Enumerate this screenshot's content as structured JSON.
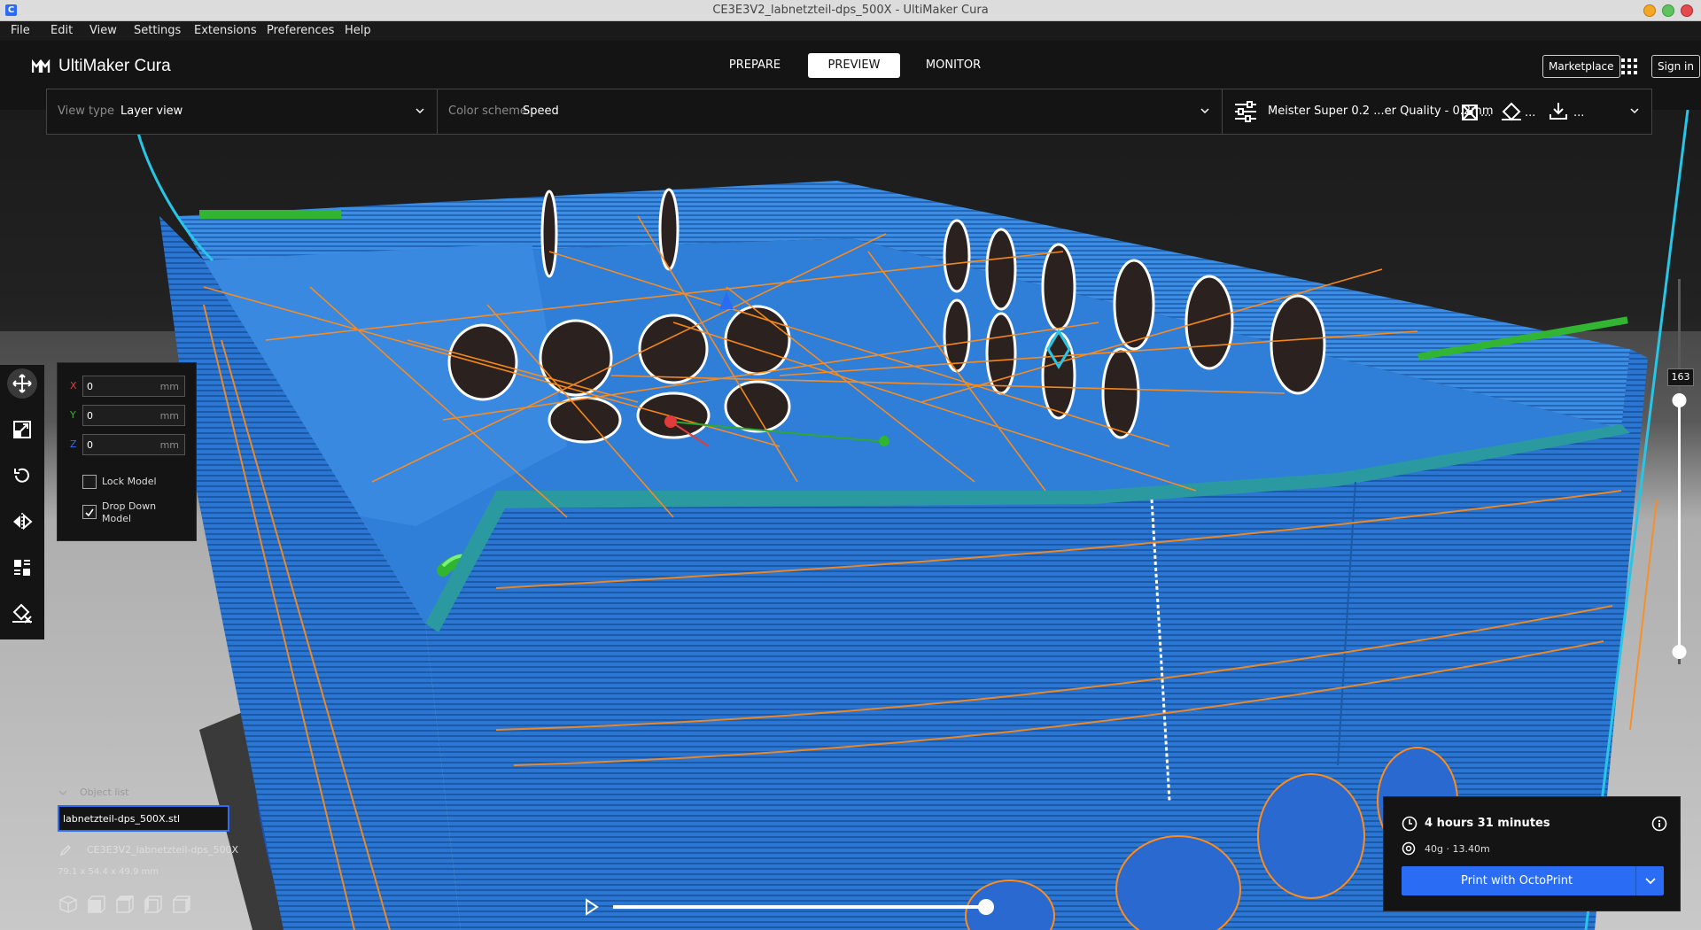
{
  "window": {
    "title": "CE3E3V2_labnetzteil-dps_500X - UltiMaker Cura"
  },
  "menu": {
    "items": [
      "File",
      "Edit",
      "View",
      "Settings",
      "Extensions",
      "Preferences",
      "Help"
    ]
  },
  "header": {
    "logo_text": "UltiMaker Cura",
    "stages": [
      "PREPARE",
      "PREVIEW",
      "MONITOR"
    ],
    "active_stage": "PREVIEW",
    "marketplace_label": "Marketplace",
    "signin_label": "Sign in"
  },
  "viewbar": {
    "view_type_label": "View type",
    "view_type_value": "Layer view",
    "color_scheme_label": "Color scheme",
    "color_scheme_value": "Speed",
    "profile_value": "Meister Super 0.2 ...er Quality - 0.2mm",
    "support_ellipsis": "...",
    "adhesion_ellipsis": "...",
    "extra_ellipsis": "..."
  },
  "move_panel": {
    "x_label": "X",
    "y_label": "Y",
    "z_label": "Z",
    "x_value": "0",
    "y_value": "0",
    "z_value": "0",
    "unit": "mm",
    "lock_model_label": "Lock Model",
    "drop_down_label": "Drop Down Model",
    "lock_model_checked": false,
    "drop_down_checked": true
  },
  "object_list": {
    "header": "Object list",
    "file_name": "labnetzteil-dps_500X.stl",
    "object_name": "CE3E3V2_labnetzteil-dps_500X",
    "dimensions": "79.1 x 54.4 x 49.9 mm"
  },
  "layer_slider": {
    "current_layer": "163"
  },
  "print_panel": {
    "time": "4 hours 31 minutes",
    "material": "40g · 13.40m",
    "print_button": "Print with OctoPrint"
  },
  "colors": {
    "accent": "#2a6df4",
    "model_blue": "#2d7ad6",
    "travel_orange": "#ff8c1a",
    "infill_green": "#3fcf3f",
    "background_dark": "#1b1b1b"
  },
  "icons": [
    "move-icon",
    "scale-icon",
    "rotate-icon",
    "mirror-icon",
    "per-model-settings-icon",
    "support-blocker-icon",
    "clock-icon",
    "info-icon",
    "weight-icon"
  ]
}
